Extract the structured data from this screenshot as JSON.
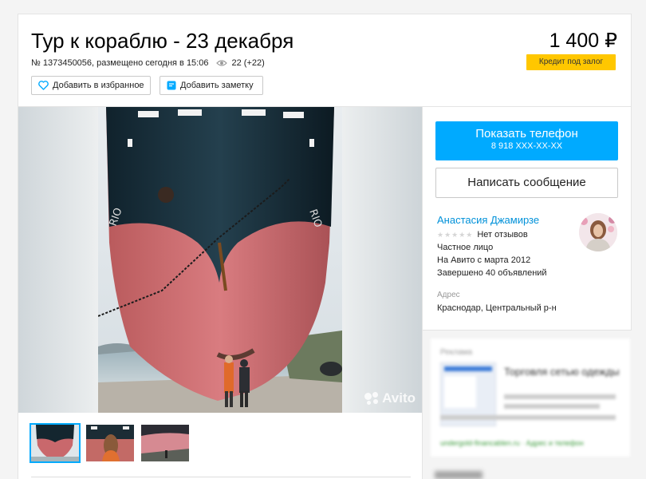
{
  "listing": {
    "title": "Тур к кораблю - 23 декабря",
    "meta": "№ 1373450056, размещено сегодня в 15:06",
    "views": "22 (+22)",
    "price": "1 400 ₽",
    "credit_badge": "Кредит под залог",
    "favorite_label": "Добавить в избранное",
    "note_label": "Добавить заметку"
  },
  "gallery": {
    "watermark": "Avito",
    "thumbnails": [
      {
        "alt": "ship with people on beach",
        "active": true
      },
      {
        "alt": "woman in orange jacket",
        "active": false
      },
      {
        "alt": "ship hull close-up",
        "active": false
      }
    ]
  },
  "contact": {
    "show_phone_label": "Показать телефон",
    "phone_masked": "8 918 XXX-XX-XX",
    "message_label": "Написать сообщение",
    "seller_name": "Анастасия Джамирзе",
    "reviews": "Нет отзывов",
    "seller_type": "Частное лицо",
    "member_since": "На Авито с марта 2012",
    "completed": "Завершено 40 объявлений",
    "address_label": "Адрес",
    "address": "Краснодар, Центральный р-н"
  },
  "ad": {
    "label": "Реклама",
    "title": "Торговля сетью одежды",
    "footer": "undergold-financablen.ru · Адрес и телефон"
  },
  "colors": {
    "accent_blue": "#00aaff",
    "link_blue": "#0091d9",
    "badge_yellow": "#ffc700"
  },
  "icons": {
    "views": "eye-icon",
    "favorite": "heart-icon",
    "note": "note-icon"
  }
}
